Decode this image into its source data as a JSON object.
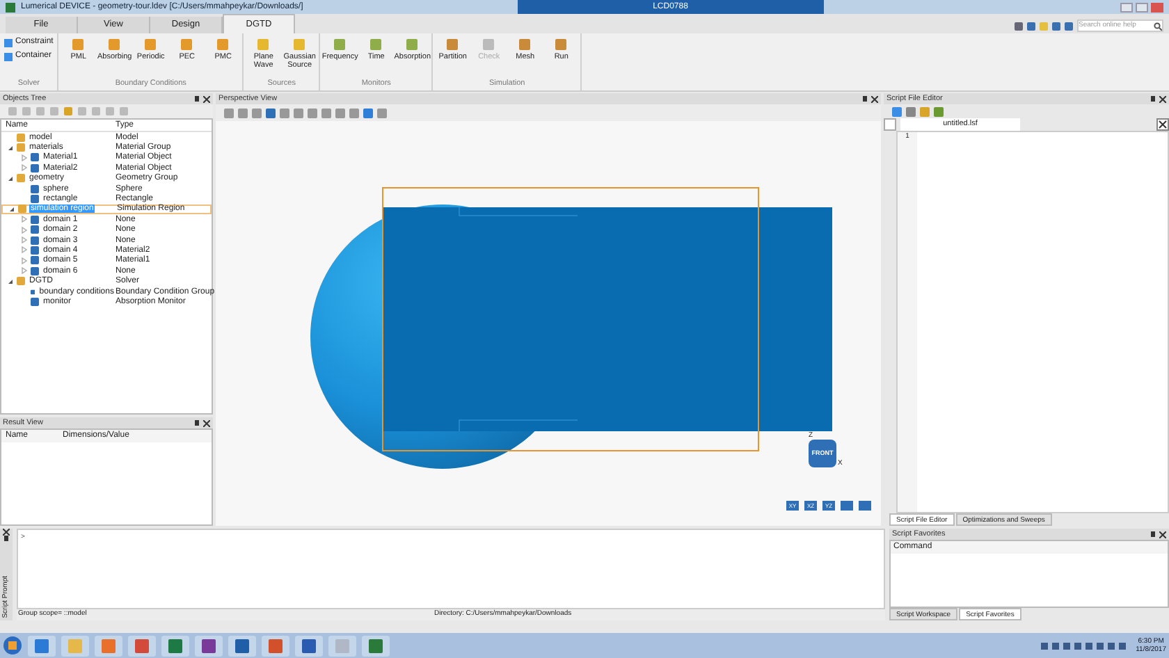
{
  "window": {
    "title": "Lumerical DEVICE - geometry-tour.ldev [C:/Users/mmahpeykar/Downloads/]",
    "remote_title": "LCD0788"
  },
  "menu_tabs": [
    {
      "label": "File",
      "selected": false
    },
    {
      "label": "View",
      "selected": false
    },
    {
      "label": "Design",
      "selected": false
    },
    {
      "label": "DGTD",
      "selected": true
    }
  ],
  "search": {
    "placeholder": "Search online help"
  },
  "ribbon": [
    {
      "group": "Solver",
      "kind": "small",
      "items": [
        {
          "label": "Constraint",
          "disabled": false
        },
        {
          "label": "Container",
          "disabled": false
        }
      ]
    },
    {
      "group": "Boundary Conditions",
      "kind": "large",
      "items": [
        {
          "label": "PML",
          "disabled": false
        },
        {
          "label": "Absorbing",
          "disabled": false
        },
        {
          "label": "Periodic",
          "disabled": false
        },
        {
          "label": "PEC",
          "disabled": false
        },
        {
          "label": "PMC",
          "disabled": false
        }
      ]
    },
    {
      "group": "Sources",
      "kind": "large",
      "items": [
        {
          "label": "Plane Wave",
          "disabled": false
        },
        {
          "label": "Gaussian Source",
          "disabled": false
        }
      ]
    },
    {
      "group": "Monitors",
      "kind": "large",
      "items": [
        {
          "label": "Frequency",
          "disabled": false
        },
        {
          "label": "Time",
          "disabled": false
        },
        {
          "label": "Absorption",
          "disabled": false
        }
      ]
    },
    {
      "group": "Simulation",
      "kind": "large",
      "items": [
        {
          "label": "Partition",
          "disabled": false
        },
        {
          "label": "Check",
          "disabled": true
        },
        {
          "label": "Mesh",
          "disabled": false
        },
        {
          "label": "Run",
          "disabled": false
        }
      ]
    }
  ],
  "objects_tree": {
    "title": "Objects Tree",
    "columns": [
      "Name",
      "Type"
    ],
    "items": [
      {
        "name": "model",
        "type": "Model",
        "selected": false
      },
      {
        "name": "materials",
        "type": "Material Group",
        "selected": false,
        "expanded": true,
        "children": [
          {
            "name": "Material1",
            "type": "Material Object",
            "selected": false,
            "expanded": false
          },
          {
            "name": "Material2",
            "type": "Material Object",
            "selected": false,
            "expanded": false
          }
        ]
      },
      {
        "name": "geometry",
        "type": "Geometry Group",
        "selected": false,
        "expanded": true,
        "children": [
          {
            "name": "sphere",
            "type": "Sphere",
            "selected": false
          },
          {
            "name": "rectangle",
            "type": "Rectangle",
            "selected": false
          }
        ]
      },
      {
        "name": "simulation region",
        "type": "Simulation Region",
        "selected": true,
        "expanded": true,
        "children": [
          {
            "name": "domain 1",
            "type": "None",
            "selected": false,
            "expanded": false
          },
          {
            "name": "domain 2",
            "type": "None",
            "selected": false,
            "expanded": false
          },
          {
            "name": "domain 3",
            "type": "None",
            "selected": false,
            "expanded": false
          },
          {
            "name": "domain 4",
            "type": "Material2",
            "selected": false,
            "expanded": false
          },
          {
            "name": "domain 5",
            "type": "Material1",
            "selected": false,
            "expanded": false
          },
          {
            "name": "domain 6",
            "type": "None",
            "selected": false,
            "expanded": false
          }
        ]
      },
      {
        "name": "DGTD",
        "type": "Solver",
        "selected": false,
        "expanded": true,
        "children": [
          {
            "name": "boundary conditions",
            "type": "Boundary Condition Group",
            "selected": false
          },
          {
            "name": "monitor",
            "type": "Absorption Monitor",
            "selected": false
          }
        ]
      }
    ]
  },
  "result_view": {
    "title": "Result View",
    "columns": [
      "Name",
      "Dimensions/Value"
    ]
  },
  "perspective_view": {
    "title": "Perspective View",
    "axis_labels": [
      "Z",
      "X"
    ],
    "orientation_label": "FRONT",
    "view_buttons": [
      "XY",
      "XZ",
      "YZ"
    ]
  },
  "script_file_editor": {
    "title": "Script File Editor",
    "tab": "untitled.lsf",
    "line_numbers": [
      "1"
    ],
    "bottom_tabs": [
      {
        "label": "Script File Editor",
        "selected": true
      },
      {
        "label": "Optimizations and Sweeps",
        "selected": false
      }
    ]
  },
  "script_prompt": {
    "title": "Script Prompt",
    "prompt": ">",
    "group_scope": "Group scope= ::model",
    "directory": "Directory: C:/Users/mmahpeykar/Downloads"
  },
  "script_favorites": {
    "title": "Script Favorites",
    "columns": [
      "Command"
    ],
    "bottom_tabs": [
      {
        "label": "Script Workspace",
        "selected": false
      },
      {
        "label": "Script Favorites",
        "selected": true
      }
    ]
  },
  "taskbar": {
    "time": "6:30 PM",
    "date": "11/8/2017"
  }
}
